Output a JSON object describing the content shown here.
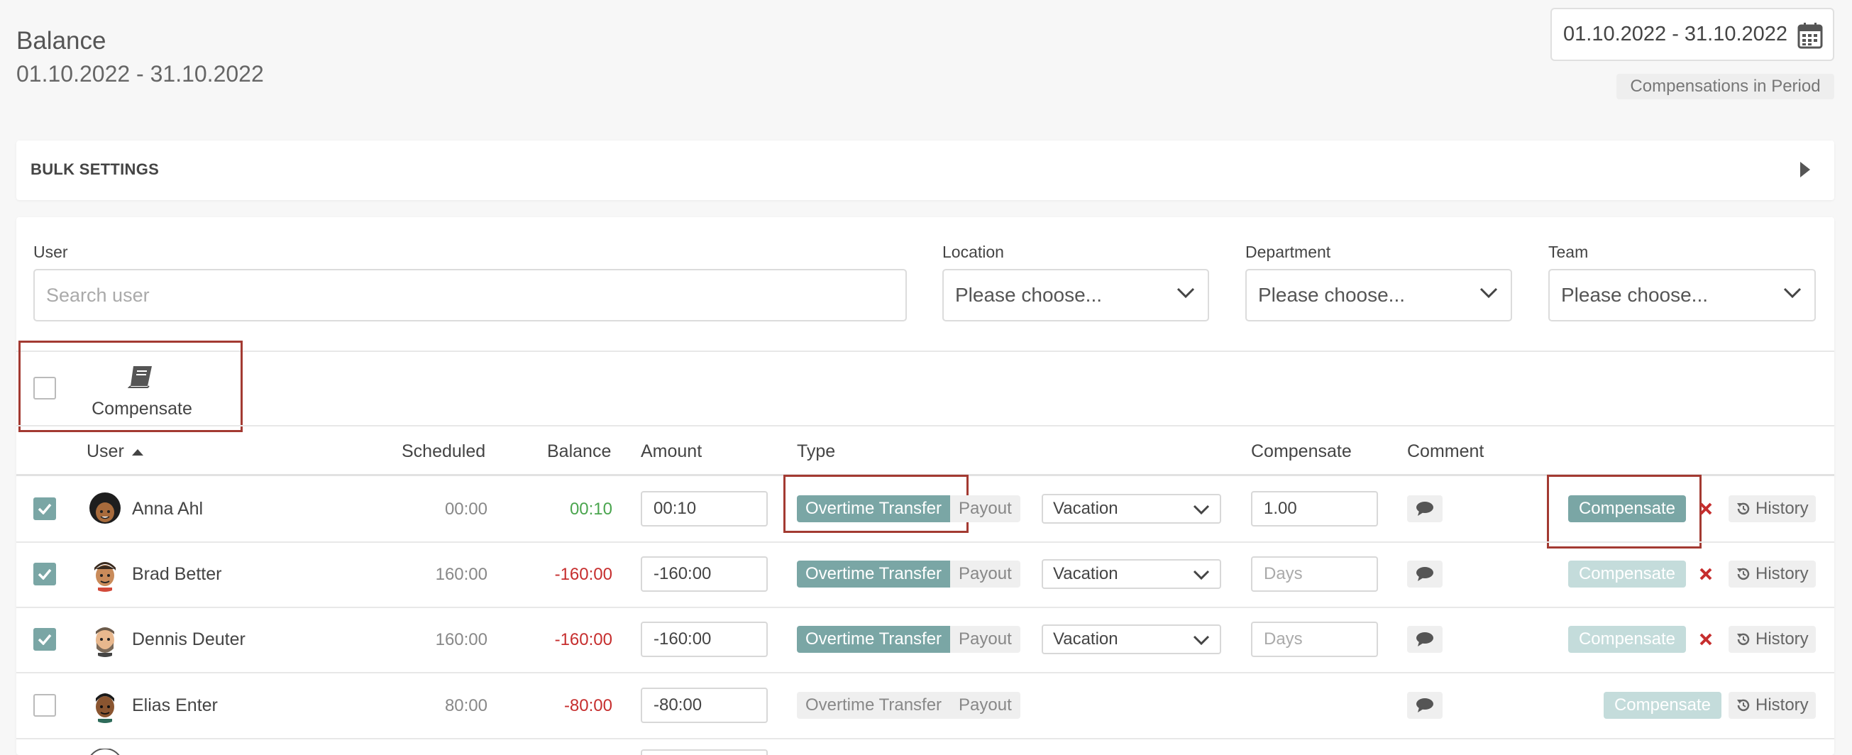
{
  "header": {
    "title": "Balance",
    "period": "01.10.2022 - 31.10.2022",
    "date_range_value": "01.10.2022 - 31.10.2022",
    "compensations_badge": "Compensations in Period"
  },
  "bulk_settings": {
    "title": "BULK SETTINGS"
  },
  "filters": {
    "user_label": "User",
    "user_placeholder": "Search user",
    "location_label": "Location",
    "location_value": "Please choose...",
    "department_label": "Department",
    "department_value": "Please choose...",
    "team_label": "Team",
    "team_value": "Please choose..."
  },
  "bulk_action": {
    "label": "Compensate",
    "icon": "book-icon"
  },
  "table": {
    "headers": {
      "user": "User",
      "scheduled": "Scheduled",
      "balance": "Balance",
      "amount": "Amount",
      "type": "Type",
      "compensate": "Compensate",
      "comment": "Comment"
    },
    "rows": [
      {
        "name": "Anna Ahl",
        "checked": true,
        "scheduled": "00:00",
        "balance": "00:10",
        "amount": "00:10",
        "type_transfer": "Overtime Transfer",
        "type_payout": "Payout",
        "type_select": "Vacation",
        "compensate_value": "1.00",
        "compensate_placeholder": "",
        "action": "Compensate",
        "history": "History"
      },
      {
        "name": "Brad Better",
        "checked": true,
        "scheduled": "160:00",
        "balance": "-160:00",
        "amount": "-160:00",
        "type_transfer": "Overtime Transfer",
        "type_payout": "Payout",
        "type_select": "Vacation",
        "compensate_value": "",
        "compensate_placeholder": "Days",
        "action": "Compensate",
        "history": "History"
      },
      {
        "name": "Dennis Deuter",
        "checked": true,
        "scheduled": "160:00",
        "balance": "-160:00",
        "amount": "-160:00",
        "type_transfer": "Overtime Transfer",
        "type_payout": "Payout",
        "type_select": "Vacation",
        "compensate_value": "",
        "compensate_placeholder": "Days",
        "action": "Compensate",
        "history": "History"
      },
      {
        "name": "Elias Enter",
        "checked": false,
        "scheduled": "80:00",
        "balance": "-80:00",
        "amount": "-80:00",
        "type_transfer": "Overtime Transfer",
        "type_payout": "Payout",
        "action": "Compensate",
        "history": "History"
      }
    ]
  },
  "colors": {
    "accent": "#7aa6a5",
    "accent_faded": "#c4dcdb",
    "positive": "#4aa54e",
    "negative": "#c62e2e",
    "highlight_border": "#a33a32"
  }
}
